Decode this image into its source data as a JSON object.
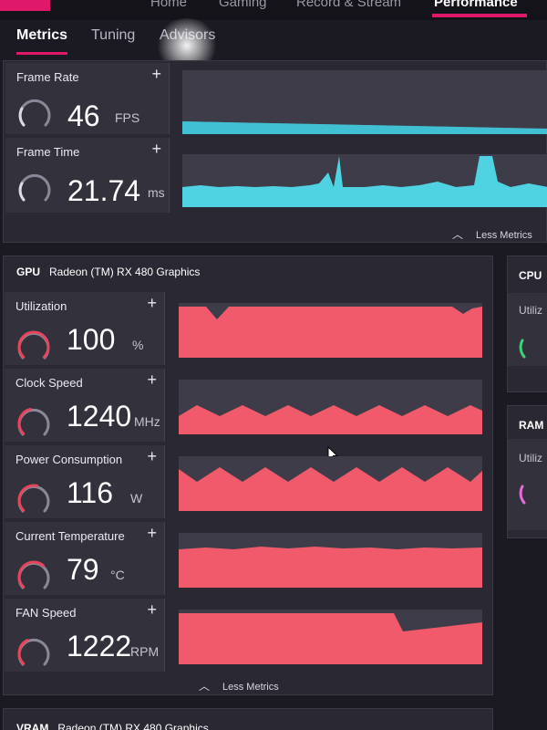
{
  "topnav": {
    "items": [
      {
        "label": "Home",
        "active": false
      },
      {
        "label": "Gaming",
        "active": false
      },
      {
        "label": "Record & Stream",
        "active": false
      },
      {
        "label": "Performance",
        "active": true
      }
    ]
  },
  "subtabs": [
    {
      "label": "Metrics",
      "active": true
    },
    {
      "label": "Tuning",
      "active": false
    },
    {
      "label": "Advisors",
      "active": false
    }
  ],
  "overlay_metrics": {
    "frame_rate": {
      "title": "Frame Rate",
      "value": "46",
      "unit": "FPS",
      "level": 0.3
    },
    "frame_time": {
      "title": "Frame Time",
      "value": "21.74",
      "unit": "ms",
      "level": 0.3
    },
    "less_metrics_label": "Less Metrics"
  },
  "gpu_panel": {
    "label": "GPU",
    "name": "Radeon (TM) RX 480 Graphics",
    "metrics": [
      {
        "title": "Utilization",
        "value": "100",
        "unit": "%",
        "level": 1.0
      },
      {
        "title": "Clock Speed",
        "value": "1240",
        "unit": "MHz",
        "level": 0.45
      },
      {
        "title": "Power Consumption",
        "value": "116",
        "unit": "W",
        "level": 0.55
      },
      {
        "title": "Current Temperature",
        "value": "79",
        "unit": "°C",
        "level": 0.65
      },
      {
        "title": "FAN Speed",
        "value": "1222",
        "unit": "RPM",
        "level": 0.4
      }
    ],
    "less_metrics_label": "Less Metrics"
  },
  "cpu_panel": {
    "label": "CPU",
    "sub": "Utiliz"
  },
  "ram_panel": {
    "label": "RAM",
    "sub": "Utiliz"
  },
  "vram_panel": {
    "label": "VRAM",
    "name": "Radeon (TM) RX 480 Graphics"
  },
  "colors": {
    "accent": "#e0186a",
    "graph_cyan": "#4fd3e3",
    "graph_red": "#f05a6a",
    "gauge_track": "#8a8896",
    "gauge_red": "#e8455c",
    "gauge_green": "#3ed07a",
    "gauge_pink": "#e86ad8"
  }
}
